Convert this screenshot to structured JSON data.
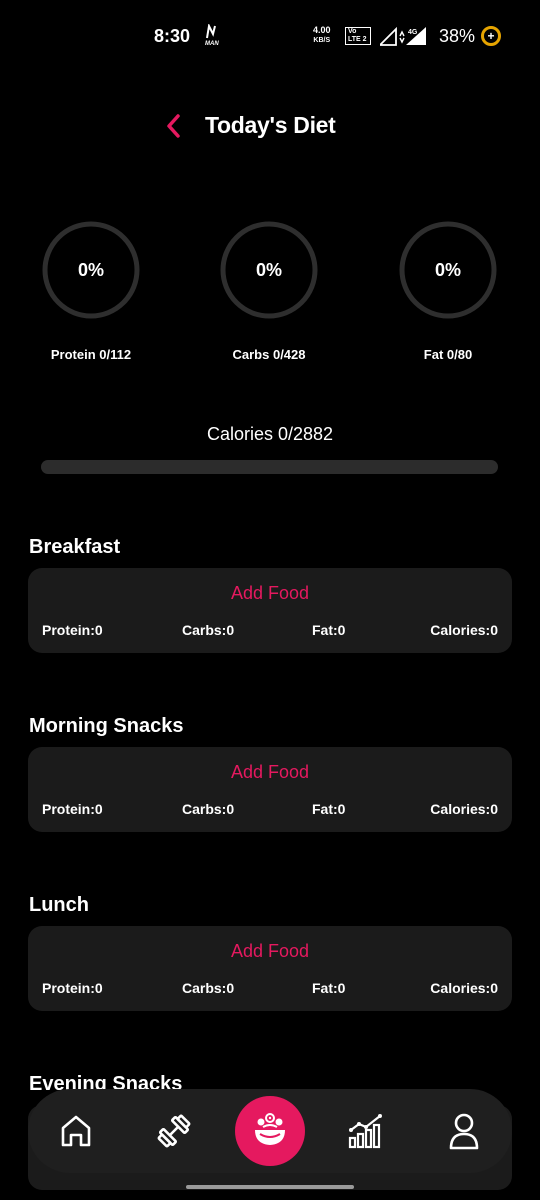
{
  "status_bar": {
    "time": "8:30",
    "network_speed_value": "4.00",
    "network_speed_unit": "KB/S",
    "volte": "Vo LTE 2",
    "signal": "4G",
    "battery": "38%",
    "battery_icon": "+"
  },
  "header": {
    "back_icon": "chevron-left-icon",
    "title": "Today's Diet"
  },
  "macros": [
    {
      "percent": "0%",
      "label": "Protein 0/112",
      "progress": 0
    },
    {
      "percent": "0%",
      "label": "Carbs 0/428",
      "progress": 0
    },
    {
      "percent": "0%",
      "label": "Fat 0/80",
      "progress": 0
    }
  ],
  "calories": {
    "label": "Calories 0/2882",
    "progress": 0
  },
  "meals": [
    {
      "name": "Breakfast",
      "add_label": "Add Food",
      "protein": "Protein:0",
      "carbs": "Carbs:0",
      "fat": "Fat:0",
      "calories": "Calories:0"
    },
    {
      "name": "Morning Snacks",
      "add_label": "Add Food",
      "protein": "Protein:0",
      "carbs": "Carbs:0",
      "fat": "Fat:0",
      "calories": "Calories:0"
    },
    {
      "name": "Lunch",
      "add_label": "Add Food",
      "protein": "Protein:0",
      "carbs": "Carbs:0",
      "fat": "Fat:0",
      "calories": "Calories:0"
    },
    {
      "name": "Evening Snacks"
    }
  ],
  "nav": {
    "items": [
      "home-icon",
      "dumbbell-icon",
      "diet-bowl-icon",
      "stats-chart-icon",
      "profile-icon"
    ],
    "active_index": 2
  },
  "colors": {
    "accent": "#e5195f",
    "background": "#000000",
    "card": "#1b1b1b",
    "ring_track": "#2e2e2e"
  }
}
